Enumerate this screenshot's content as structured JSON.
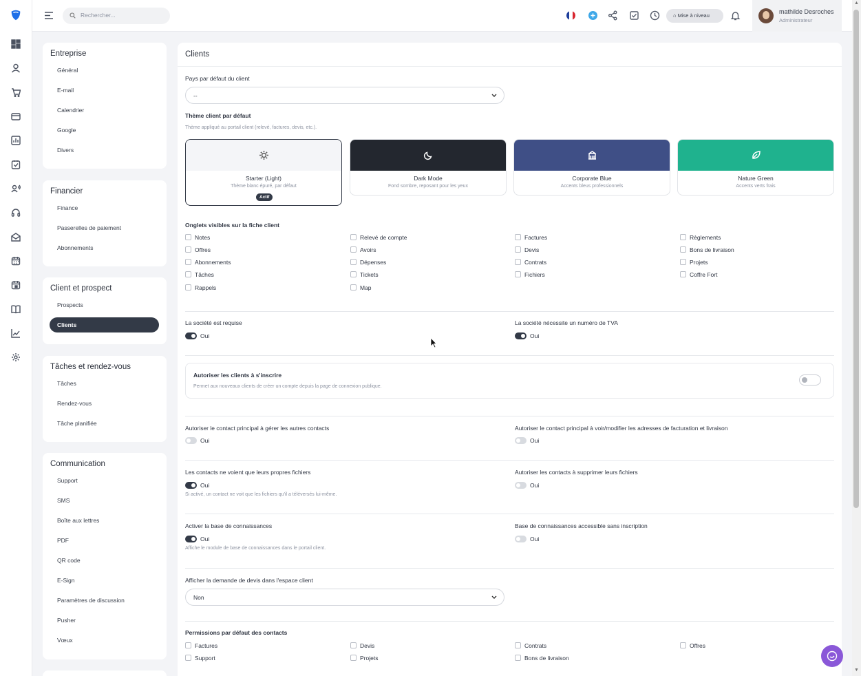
{
  "topbar": {
    "search_placeholder": "Rechercher...",
    "upgrade_label": "Mise à niveau",
    "user_name": "mathilde Desroches",
    "user_role": "Administrateur"
  },
  "nav": {
    "entreprise": {
      "title": "Entreprise",
      "items": [
        "Général",
        "E-mail",
        "Calendrier",
        "Google",
        "Divers"
      ]
    },
    "financier": {
      "title": "Financier",
      "items": [
        "Finance",
        "Passerelles de paiement",
        "Abonnements"
      ]
    },
    "client": {
      "title": "Client et prospect",
      "items": [
        "Prospects",
        "Clients"
      ]
    },
    "taches": {
      "title": "Tâches et rendez-vous",
      "items": [
        "Tâches",
        "Rendez-vous",
        "Tâche planifiée"
      ]
    },
    "communication": {
      "title": "Communication",
      "items": [
        "Support",
        "SMS",
        "Boîte aux lettres",
        "PDF",
        "QR code",
        "E-Sign",
        "Paramètres de discussion",
        "Pusher",
        "Vœux"
      ]
    }
  },
  "main": {
    "title": "Clients",
    "country_label": "Pays par défaut du client",
    "country_value": "--",
    "theme_label": "Thème client par défaut",
    "theme_hint": "Thème appliqué au portail client (relevé, factures, devis, etc.).",
    "themes": [
      {
        "name": "Starter (Light)",
        "desc": "Thème blanc épuré, par défaut",
        "badge": "Actif",
        "color": "#f4f5f8",
        "icon": "sun-icon"
      },
      {
        "name": "Dark Mode",
        "desc": "Fond sombre, reposant pour les yeux",
        "color": "#23272f",
        "icon": "moon-icon"
      },
      {
        "name": "Corporate Blue",
        "desc": "Accents bleus professionnels",
        "color": "#3f4f86",
        "icon": "building-icon"
      },
      {
        "name": "Nature Green",
        "desc": "Accents verts frais",
        "color": "#1fb28e",
        "icon": "leaf-icon"
      }
    ],
    "tabs_label": "Onglets visibles sur la fiche client",
    "tabs_checkboxes": [
      [
        "Notes",
        "Relevé de compte",
        "Factures",
        "Règlements"
      ],
      [
        "Offres",
        "Avoirs",
        "Devis",
        "Bons de livraison"
      ],
      [
        "Abonnements",
        "Dépenses",
        "Contrats",
        "Projets"
      ],
      [
        "Tâches",
        "Tickets",
        "Fichiers",
        "Coffre Fort"
      ],
      [
        "Rappels",
        "Map"
      ]
    ],
    "company_required": {
      "label": "La société est requise",
      "value": "Oui",
      "on": true
    },
    "vat_required": {
      "label": "La société nécessite un numéro de TVA",
      "value": "Oui",
      "on": true
    },
    "signup": {
      "label": "Autoriser les clients à s'inscrire",
      "hint": "Permet aux nouveaux clients de créer un compte depuis la page de connexion publique.",
      "on": false
    },
    "manage_contacts": {
      "label": "Autoriser le contact principal à gérer les autres contacts",
      "value": "Oui",
      "on": false
    },
    "manage_addresses": {
      "label": "Autoriser le contact principal à voir/modifier les adresses de facturation et livraison",
      "value": "Oui",
      "on": false
    },
    "own_files": {
      "label": "Les contacts ne voient que leurs propres fichiers",
      "value": "Oui",
      "on": true,
      "hint": "Si activé, un contact ne voit que les fichiers qu'il a téléversés lui-même."
    },
    "delete_files": {
      "label": "Autoriser les contacts à supprimer leurs fichiers",
      "value": "Oui",
      "on": false
    },
    "kb_enable": {
      "label": "Activer la base de connaissances",
      "value": "Oui",
      "on": true,
      "hint": "Affiche le module de base de connaissances dans le portail client."
    },
    "kb_public": {
      "label": "Base de connaissances accessible sans inscription",
      "value": "Oui",
      "on": false
    },
    "quote_label": "Afficher la demande de devis dans l'espace client",
    "quote_value": "Non",
    "perms_label": "Permissions par défaut des contacts",
    "perms_checkboxes": [
      [
        "Factures",
        "Devis",
        "Contrats",
        "Offres"
      ],
      [
        "Support",
        "Projets",
        "Bons de livraison"
      ]
    ]
  }
}
